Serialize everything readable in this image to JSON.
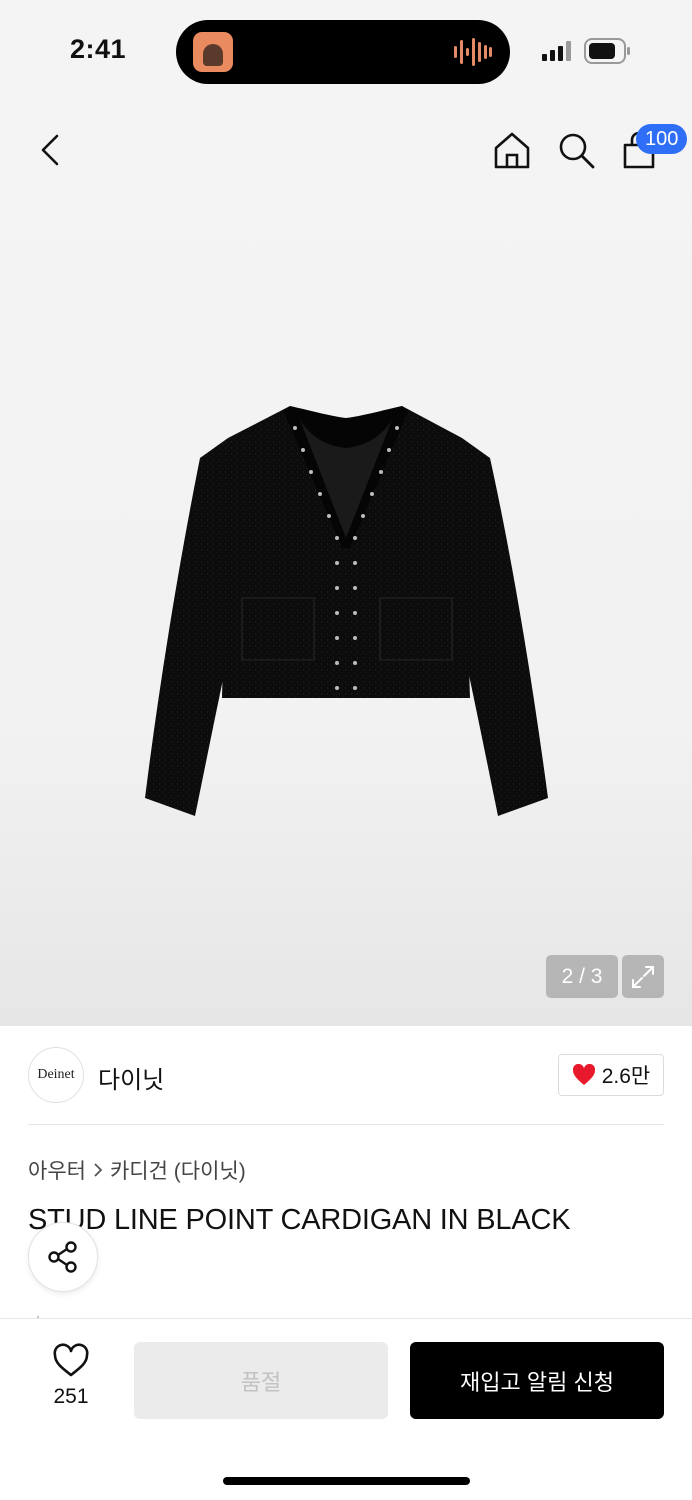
{
  "status": {
    "time": "2:41"
  },
  "header": {
    "cart_count": "100",
    "icons": [
      "chevron-left-icon",
      "home-icon",
      "search-icon",
      "shopping-bag-icon"
    ]
  },
  "gallery": {
    "pager": "2 / 3",
    "image": "black-cardigan-photo"
  },
  "brand": {
    "logo_text": "Deinet",
    "name": "다이닛",
    "likes": "2.6만"
  },
  "breadcrumb": {
    "category": "아우터",
    "subcategory": "카디건 (다이닛)"
  },
  "product": {
    "title": "STUD LINE POINT CARDIGAN IN BLACK"
  },
  "bottom_bar": {
    "wish_count": "251",
    "soldout_label": "품절",
    "restock_label": "재입고 알림 신청"
  },
  "colors": {
    "badge": "#2f6ef6",
    "heart": "#e8192c",
    "primary_button": "#000000"
  }
}
